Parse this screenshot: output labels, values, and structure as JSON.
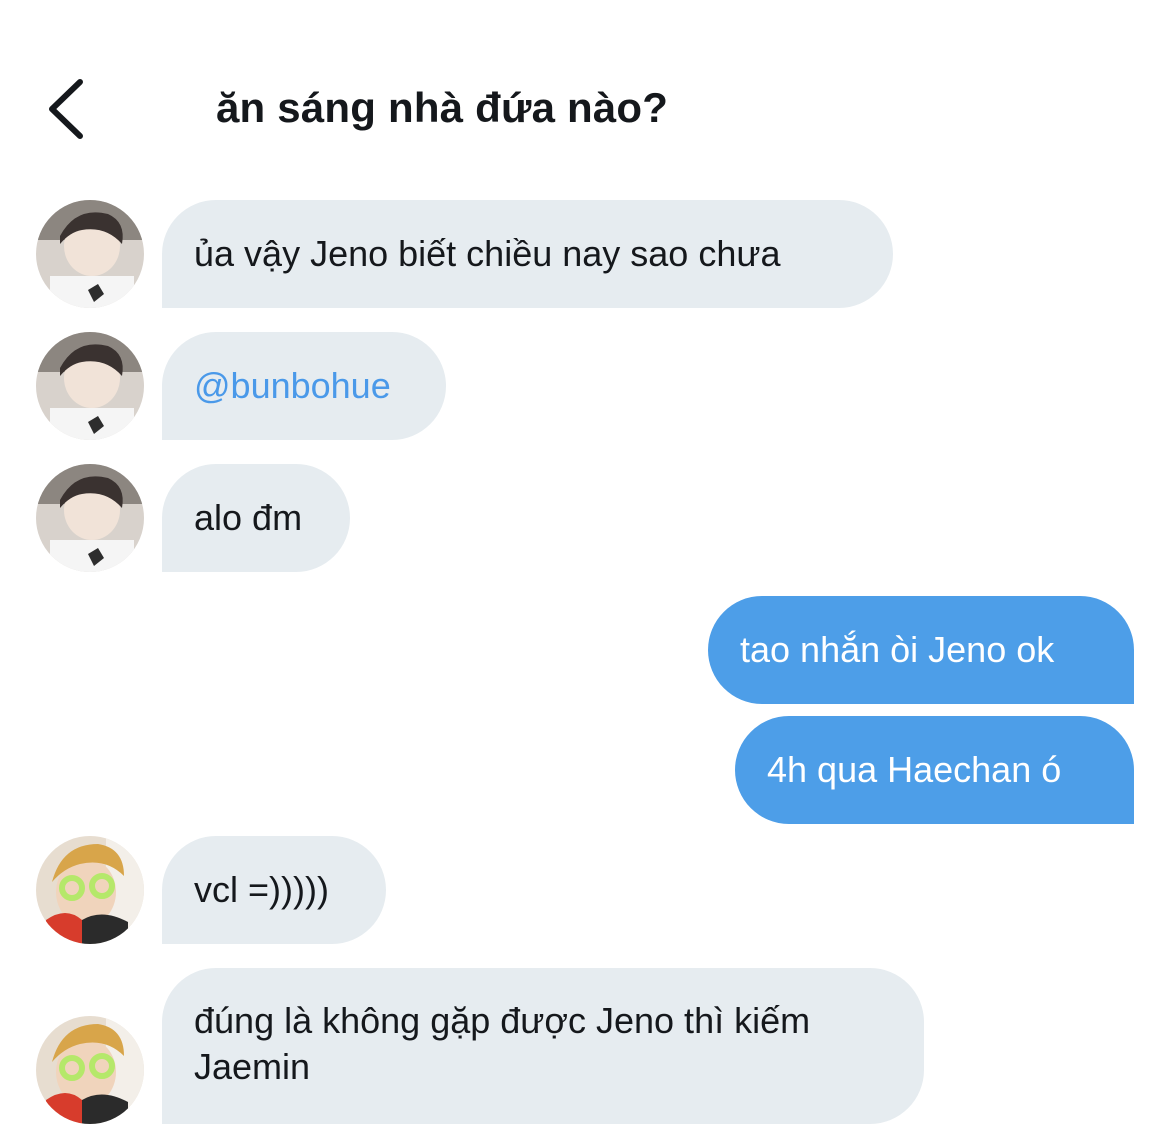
{
  "header": {
    "back_icon": "chevron-left-icon",
    "title": "ăn sáng nhà đứa nào?"
  },
  "messages": [
    {
      "sender": "avatar-a",
      "direction": "incoming",
      "text": "ủa vậy Jeno biết chiều nay sao chưa"
    },
    {
      "sender": "avatar-a",
      "direction": "incoming",
      "text": "@bunbohue",
      "is_mention": true
    },
    {
      "sender": "avatar-a",
      "direction": "incoming",
      "text": "alo đm"
    },
    {
      "sender": "me",
      "direction": "outgoing",
      "text": "tao nhắn òi Jeno ok"
    },
    {
      "sender": "me",
      "direction": "outgoing",
      "text": "4h qua Haechan ó"
    },
    {
      "sender": "avatar-b",
      "direction": "incoming",
      "text": "vcl =)))))"
    },
    {
      "sender": "avatar-b",
      "direction": "incoming",
      "text": "đúng là không gặp được Jeno thì kiếm Jaemin"
    }
  ],
  "colors": {
    "incoming_bubble": "#e6ecf0",
    "outgoing_bubble": "#4d9ee8",
    "mention": "#4a99e9",
    "text": "#15181c"
  }
}
